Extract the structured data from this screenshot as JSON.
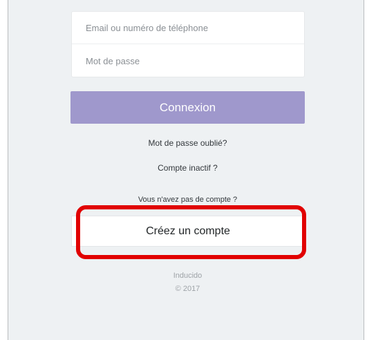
{
  "form": {
    "email_placeholder": "Email ou numéro de téléphone",
    "password_placeholder": "Mot de passe",
    "login_label": "Connexion"
  },
  "links": {
    "forgot_password": "Mot de passe oublié?",
    "inactive_account": "Compte inactif ?",
    "no_account": "Vous n'avez pas de compte ?"
  },
  "signup": {
    "create_account_label": "Créez un compte"
  },
  "footer": {
    "brand": "Inducido",
    "copyright": "© 2017"
  },
  "colors": {
    "login_button": "#9f98cc",
    "highlight": "#e10000",
    "background": "#eef1f3"
  }
}
